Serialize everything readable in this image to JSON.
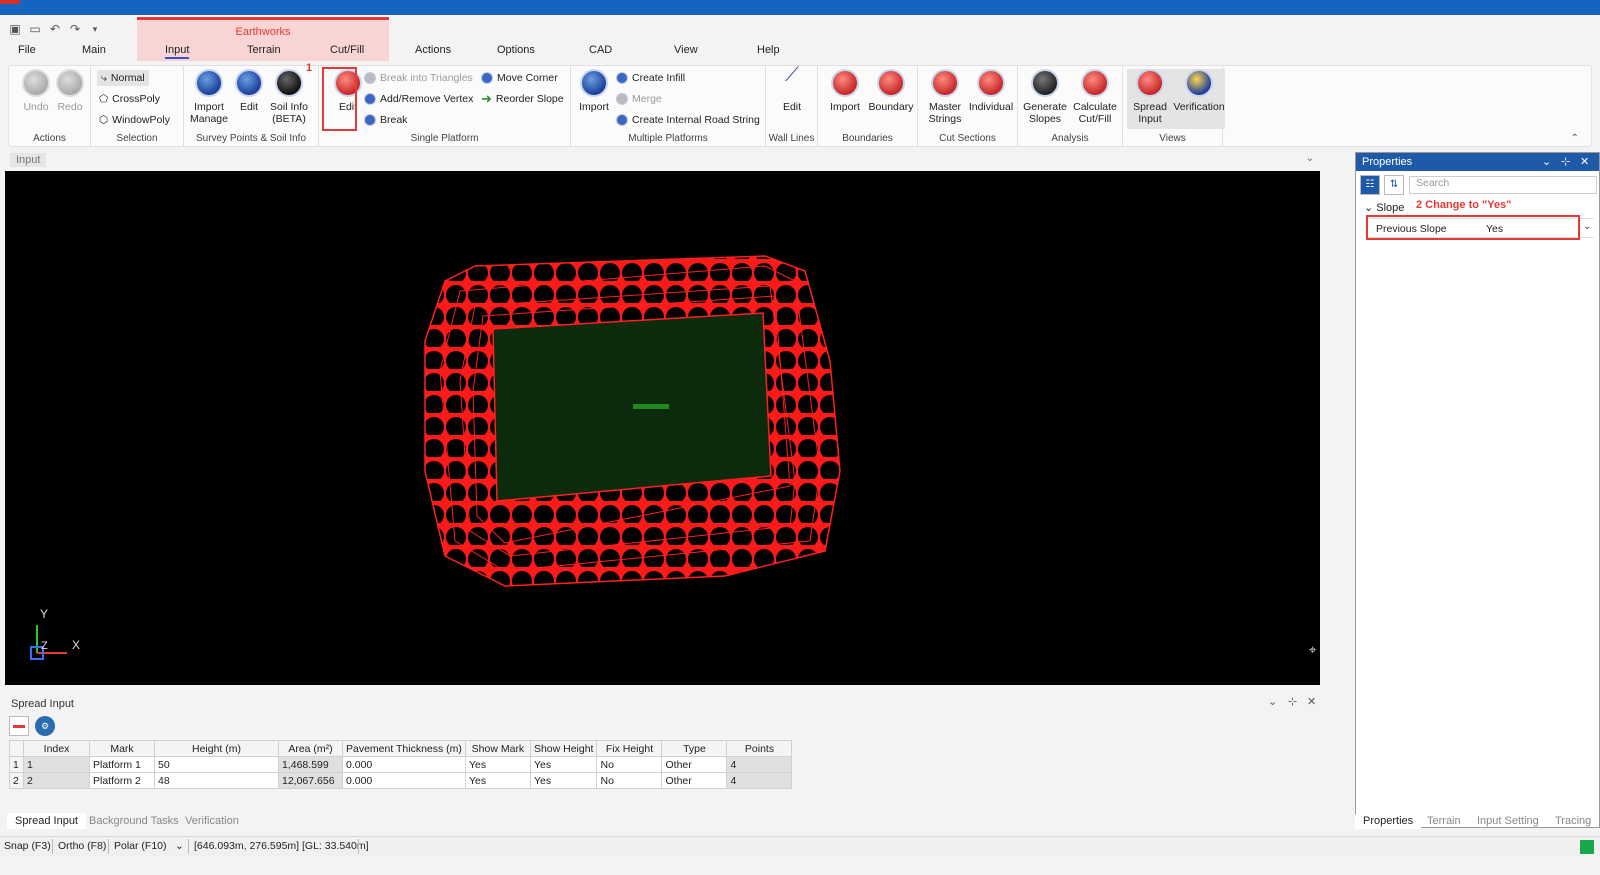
{
  "colors": {
    "accent": "#1e5aa8",
    "context": "#e53935",
    "titlebar": "#1565c0",
    "viewport": "#000000",
    "platform": "#ff0000"
  },
  "context_tab": {
    "label": "Earthworks"
  },
  "menu_tabs": [
    "File",
    "Main",
    "Input",
    "Terrain",
    "Cut/Fill",
    "Actions",
    "Options",
    "CAD",
    "View",
    "Help"
  ],
  "active_tab": "Input",
  "ribbon": {
    "actions": {
      "label": "Actions",
      "undo": "Undo",
      "redo": "Redo"
    },
    "selection": {
      "label": "Selection",
      "normal": "Normal",
      "crosspoly": "CrossPoly",
      "windowpoly": "WindowPoly"
    },
    "survey": {
      "label": "Survey Points & Soil Info",
      "import": "Import\nManage",
      "import_l1": "Import",
      "import_l2": "Manage",
      "edit": "Edit",
      "soil_l1": "Soil Info",
      "soil_l2": "(BETA)"
    },
    "single": {
      "label": "Single Platform",
      "edit": "Edit",
      "break_triangles": "Break into Triangles",
      "add_remove": "Add/Remove Vertex",
      "break": "Break",
      "move_corner": "Move Corner",
      "reorder": "Reorder Slope"
    },
    "multiple": {
      "label": "Multiple Platforms",
      "import": "Import",
      "create_infill": "Create Infill",
      "merge": "Merge",
      "internal_road": "Create Internal Road String"
    },
    "wall": {
      "label": "Wall Lines",
      "edit": "Edit"
    },
    "boundaries": {
      "label": "Boundaries",
      "import": "Import",
      "boundary": "Boundary"
    },
    "cut": {
      "label": "Cut Sections",
      "master_l1": "Master",
      "master_l2": "Strings",
      "individual": "Individual"
    },
    "analysis": {
      "label": "Analysis",
      "gen_l1": "Generate",
      "gen_l2": "Slopes",
      "calc_l1": "Calculate",
      "calc_l2": "Cut/Fill"
    },
    "views": {
      "label": "Views",
      "spread_l1": "Spread",
      "spread_l2": "Input",
      "verification": "Verification"
    }
  },
  "annotations": {
    "step1": "1",
    "step2": "2 Change to \"Yes\""
  },
  "document_tab": "Input",
  "viewport": {
    "axis_y": "Y",
    "axis_x": "X",
    "axis_z": "Z"
  },
  "spread_input": {
    "title": "Spread Input",
    "columns": [
      "Index",
      "Mark",
      "Height (m)",
      "Area (m²)",
      "Pavement Thickness (m)",
      "Show Mark",
      "Show Height",
      "Fix Height",
      "Type",
      "Points"
    ],
    "rows": [
      {
        "rownum": "1",
        "index": "1",
        "mark": "Platform 1",
        "height": "50",
        "area": "1,468.599",
        "pavement": "0.000",
        "show_mark": "Yes",
        "show_height": "Yes",
        "fix_height": "No",
        "type": "Other",
        "points": "4"
      },
      {
        "rownum": "2",
        "index": "2",
        "mark": "Platform 2",
        "height": "48",
        "area": "12,067.656",
        "pavement": "0.000",
        "show_mark": "Yes",
        "show_height": "Yes",
        "fix_height": "No",
        "type": "Other",
        "points": "4"
      }
    ]
  },
  "bottom_tabs": [
    "Spread Input",
    "Background Tasks",
    "Verification"
  ],
  "status": {
    "snap": "Snap (F3)",
    "ortho": "Ortho (F8)",
    "polar": "Polar (F10)",
    "coords": "[646.093m, 276.595m] [GL: 33.540m]"
  },
  "properties": {
    "title": "Properties",
    "search_placeholder": "Search",
    "category": "Slope",
    "row_name": "Previous Slope",
    "row_value": "Yes",
    "bottom_tabs": [
      "Properties",
      "Terrain",
      "Input Setting",
      "Tracing"
    ]
  }
}
